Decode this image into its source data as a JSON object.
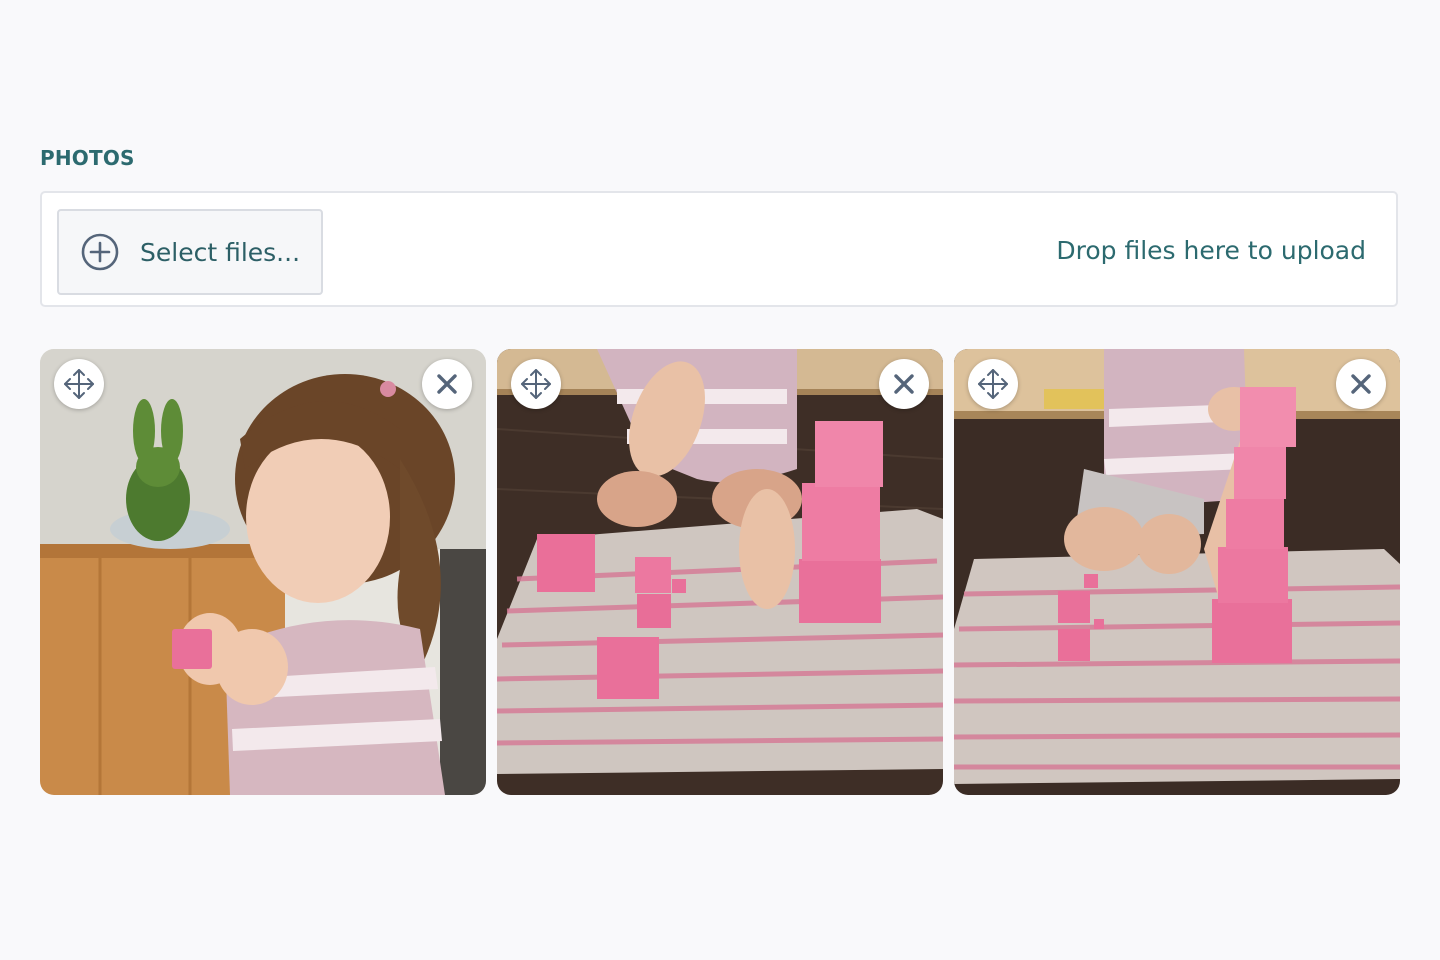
{
  "photos_section": {
    "label": "PHOTOS",
    "select_files_label": "Select files...",
    "drop_hint": "Drop files here to upload"
  },
  "photos": [
    {
      "move_icon": "move-arrows-icon",
      "remove_icon": "close-icon"
    },
    {
      "move_icon": "move-arrows-icon",
      "remove_icon": "close-icon"
    },
    {
      "move_icon": "move-arrows-icon",
      "remove_icon": "close-icon"
    }
  ],
  "colors": {
    "accent_text": "#2c6a6f",
    "icon_gray": "#55657a",
    "page_bg": "#f9f9fb",
    "block_pink": "#e9709a"
  }
}
